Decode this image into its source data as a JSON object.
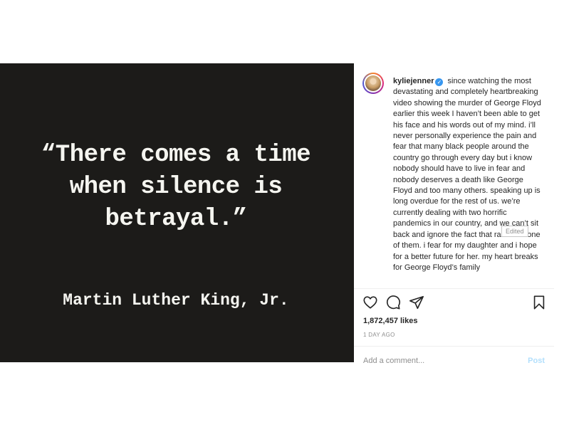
{
  "media": {
    "quote_lines": [
      "“There comes a time",
      "when silence is",
      "betrayal.”"
    ],
    "attribution": "Martin Luther King, Jr."
  },
  "post": {
    "username": "kyliejenner",
    "verified_icon": "✓",
    "caption": "since watching the most devastating and completely heartbreaking video showing the murder of George Floyd earlier this week I haven’t been able to get his face and his words out of my mind. i’ll never personally experience the pain and fear that many black people around the country go through every day but i know nobody should have to live in fear and nobody deserves a death like George Floyd and too many others. speaking up is long overdue for the rest of us. we’re currently dealing with two horrific pandemics in our country, and we can’t sit back and ignore the fact that racism is one of them. i fear for my daughter and i hope for a better future for her. my heart breaks for George Floyd’s family",
    "edited_label": "Edited",
    "likes": "1,872,457 likes",
    "time": "1 DAY AGO",
    "comment_placeholder": "Add a comment...",
    "post_label": "Post"
  },
  "icons": {
    "like": "heart-icon",
    "comment": "comment-icon",
    "share": "share-icon",
    "save": "bookmark-icon"
  },
  "colors": {
    "media_background": "#1c1b19",
    "quote_text": "#f5f5f0",
    "verified_badge": "#3897f0",
    "secondary_text": "#8e8e8e"
  }
}
